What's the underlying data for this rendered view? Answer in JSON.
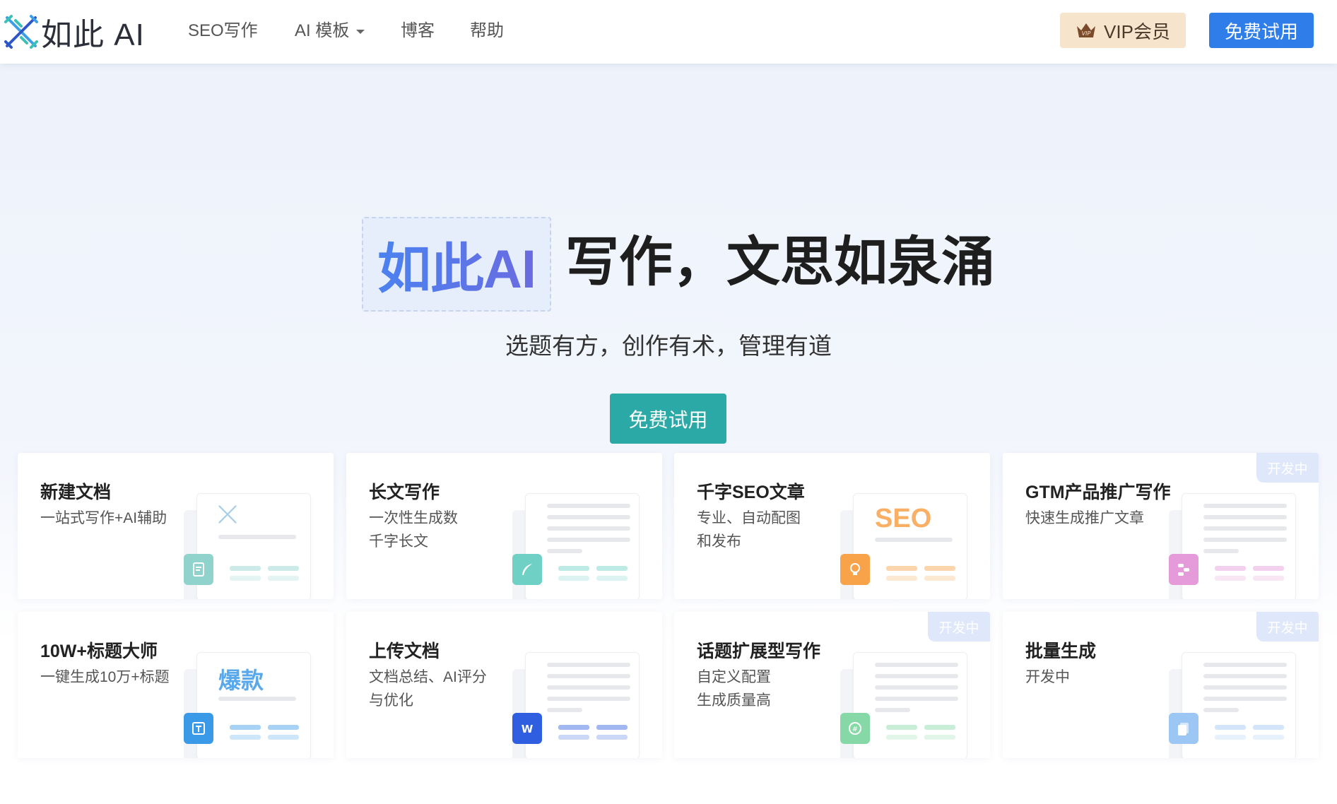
{
  "header": {
    "logo_text": "如此 AI",
    "nav": [
      {
        "label": "SEO写作"
      },
      {
        "label": "AI 模板"
      },
      {
        "label": "博客"
      },
      {
        "label": "帮助"
      }
    ],
    "vip_label": "VIP会员",
    "trial_label": "免费试用"
  },
  "hero": {
    "brand": "如此AI",
    "title": "写作，文思如泉涌",
    "subtitle": "选题有方，创作有术，管理有道",
    "cta": "免费试用"
  },
  "cards": [
    {
      "title": "新建文档",
      "desc": "一站式写作+AI辅助",
      "accent": "#8fd3cc",
      "icon": "document-icon",
      "big": "",
      "badge": ""
    },
    {
      "title": "长文写作",
      "desc": "一次性生成数\n千字长文",
      "accent": "#6fd0c6",
      "icon": "feather-icon",
      "big": "",
      "badge": ""
    },
    {
      "title": "千字SEO文章",
      "desc": "专业、自动配图\n和发布",
      "accent": "#f8a24a",
      "icon": "lightbulb-icon",
      "big": "SEO",
      "badge": ""
    },
    {
      "title": "GTM产品推广写作",
      "desc": "快速生成推广文章",
      "accent": "#e59ad9",
      "icon": "flow-icon",
      "big": "",
      "badge": "开发中"
    },
    {
      "title": "10W+标题大师",
      "desc": "一键生成10万+标题",
      "accent": "#3b9ae8",
      "icon": "text-t-icon",
      "big": "爆款",
      "badge": ""
    },
    {
      "title": "上传文档",
      "desc": "文档总结、AI评分\n与优化",
      "accent": "#2f5fe0",
      "icon": "word-icon",
      "big": "",
      "badge": ""
    },
    {
      "title": "话题扩展型写作",
      "desc": "自定义配置\n生成质量高",
      "accent": "#86d9a6",
      "icon": "hashtag-icon",
      "big": "",
      "badge": "开发中"
    },
    {
      "title": "批量生成",
      "desc": "开发中",
      "accent": "#9cc6f3",
      "icon": "batch-docs-icon",
      "big": "",
      "badge": "开发中"
    }
  ]
}
